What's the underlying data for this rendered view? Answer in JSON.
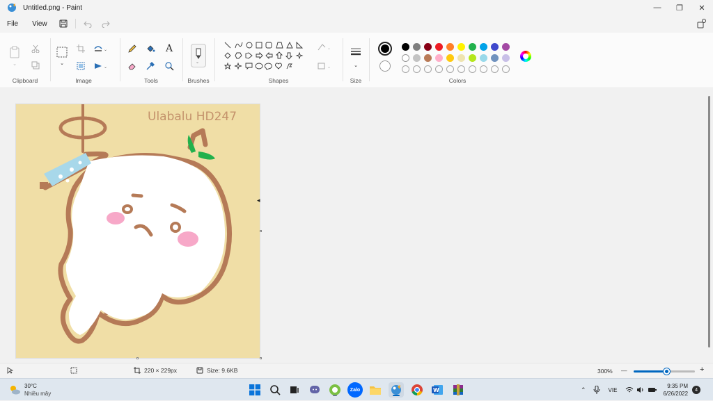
{
  "window": {
    "title": "Untitled.png - Paint",
    "minimize_glyph": "—",
    "maximize_glyph": "❐",
    "close_glyph": "✕"
  },
  "menu": {
    "file": "File",
    "view": "View"
  },
  "ribbon": {
    "clipboard_label": "Clipboard",
    "image_label": "Image",
    "tools_label": "Tools",
    "brushes_label": "Brushes",
    "shapes_label": "Shapes",
    "size_label": "Size",
    "colors_label": "Colors",
    "text_tool_glyph": "A"
  },
  "colors": {
    "primary": "#000000",
    "secondary": "#ffffff",
    "row1": [
      "#000000",
      "#7f7f7f",
      "#880015",
      "#ed1c24",
      "#ff7f27",
      "#fff200",
      "#22b14c",
      "#00a2e8",
      "#3f48cc",
      "#a349a4"
    ],
    "row2": [
      "#ffffff",
      "#c3c3c3",
      "#b97a57",
      "#ffaec9",
      "#ffc90e",
      "#efe4b0",
      "#b5e61d",
      "#99d9ea",
      "#7092be",
      "#c8bfe7"
    ],
    "row3_empty_count": 10
  },
  "canvas": {
    "watermark": "Ulabalu HD247",
    "background": "#f0dea6",
    "outline_color": "#b57a57",
    "cheek_color": "#f7a8c8",
    "leaf_color": "#22b14c",
    "sleeve_color": "#a8d8ea"
  },
  "status": {
    "dimensions": "220 × 229px",
    "size": "Size: 9.6KB",
    "zoom": "300%",
    "zoom_minus": "—",
    "zoom_plus": "+",
    "zoom_level_fraction": 0.55
  },
  "taskbar": {
    "weather_temp": "30°C",
    "weather_desc": "Nhiều mây",
    "language": "VIE",
    "time": "9:35 PM",
    "date": "6/26/2022",
    "notification_count": "4",
    "zalo_label": "Zalo"
  }
}
